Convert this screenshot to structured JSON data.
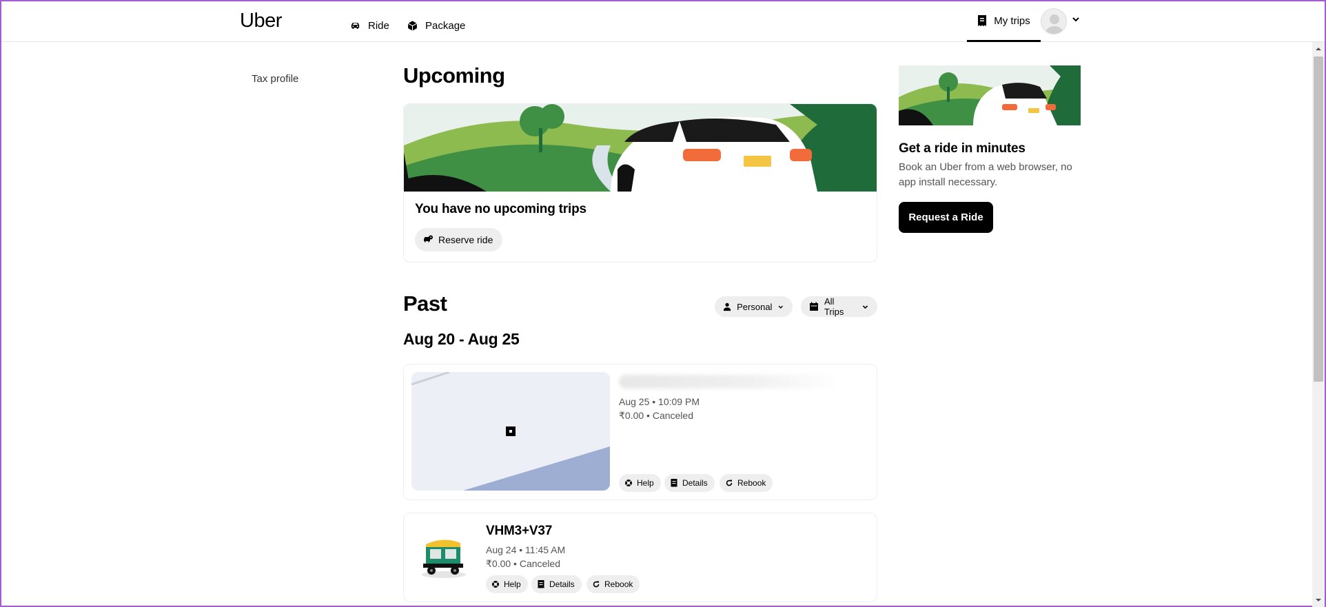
{
  "header": {
    "logo": "Uber",
    "nav": [
      {
        "label": "Ride",
        "icon": "car-icon"
      },
      {
        "label": "Package",
        "icon": "package-icon"
      }
    ],
    "my_trips": "My trips"
  },
  "sidebar": {
    "items": [
      {
        "label": "Tax profile"
      }
    ]
  },
  "upcoming": {
    "title": "Upcoming",
    "empty_text": "You have no upcoming trips",
    "reserve_label": "Reserve ride"
  },
  "past": {
    "title": "Past",
    "filters": [
      {
        "label": "Personal",
        "icon": "person-icon"
      },
      {
        "label": "All Trips",
        "icon": "calendar-icon"
      }
    ],
    "group_label": "Aug 20 - Aug 25",
    "trips": [
      {
        "title": "",
        "datetime": "Aug 25 • 10:09 PM",
        "price_status": "₹0.00 • Canceled",
        "actions": [
          "Help",
          "Details",
          "Rebook"
        ]
      },
      {
        "title": "VHM3+V37",
        "datetime": "Aug 24 • 11:45 AM",
        "price_status": "₹0.00 • Canceled",
        "actions": [
          "Help",
          "Details",
          "Rebook"
        ]
      }
    ]
  },
  "promo": {
    "title": "Get a ride in minutes",
    "text": "Book an Uber from a web browser, no app install necessary.",
    "button": "Request a Ride"
  },
  "colors": {
    "accent": "#000000",
    "pill_bg": "#eeeeee",
    "muted_text": "#545454",
    "green_dark": "#1f6b3a",
    "green_light": "#8dbb4f",
    "taillight": "#f26b3a",
    "map_route": "#9eaed3"
  }
}
